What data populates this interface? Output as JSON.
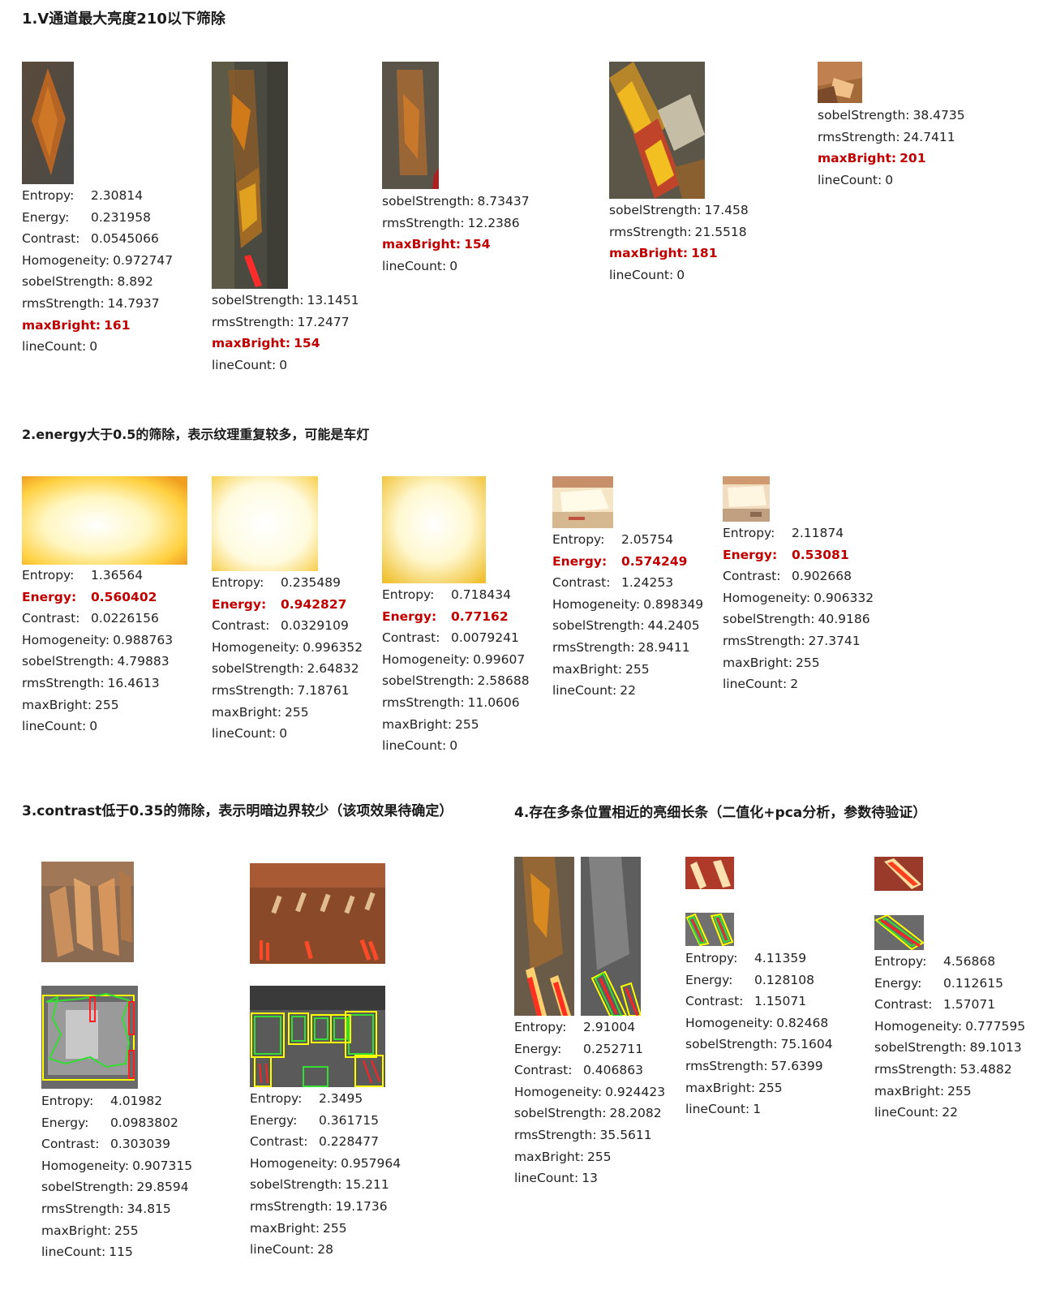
{
  "sections": {
    "s1": "1.V通道最大亮度210以下筛除",
    "s2": "2.energy大于0.5的筛除，表示纹理重复较多，可能是车灯",
    "s3": "3.contrast低于0.35的筛除，表示明暗边界较少（该项效果待确定）",
    "s4": "4.存在多条位置相近的亮细长条（二值化+pca分析，参数待验证）"
  },
  "samples": {
    "a1": [
      [
        "Entropy:",
        "2.30814",
        false
      ],
      [
        "Energy:",
        "0.231958",
        false
      ],
      [
        "Contrast:",
        "0.0545066",
        false
      ],
      [
        "Homogeneity:",
        "0.972747",
        false
      ],
      [
        "sobelStrength:",
        "8.892",
        false
      ],
      [
        "rmsStrength:",
        "14.7937",
        false
      ],
      [
        "maxBright:",
        "161",
        true
      ],
      [
        "lineCount:",
        "0",
        false
      ]
    ],
    "a2": [
      [
        "sobelStrength:",
        "13.1451",
        false
      ],
      [
        "rmsStrength:",
        "17.2477",
        false
      ],
      [
        "maxBright:",
        "154",
        true
      ],
      [
        "lineCount:",
        "0",
        false
      ]
    ],
    "a3": [
      [
        "sobelStrength:",
        "8.73437",
        false
      ],
      [
        "rmsStrength:",
        "12.2386",
        false
      ],
      [
        "maxBright:",
        "154",
        true
      ],
      [
        "lineCount:",
        "0",
        false
      ]
    ],
    "a4": [
      [
        "sobelStrength:",
        "17.458",
        false
      ],
      [
        "rmsStrength:",
        "21.5518",
        false
      ],
      [
        "maxBright:",
        "181",
        true
      ],
      [
        "lineCount:",
        "0",
        false
      ]
    ],
    "a5": [
      [
        "sobelStrength:",
        "38.4735",
        false
      ],
      [
        "rmsStrength:",
        "24.7411",
        false
      ],
      [
        "maxBright:",
        "201",
        true
      ],
      [
        "lineCount:",
        "0",
        false
      ]
    ],
    "b1": [
      [
        "Entropy:",
        "1.36564",
        false
      ],
      [
        "Energy:",
        "0.560402",
        true
      ],
      [
        "Contrast:",
        "0.0226156",
        false
      ],
      [
        "Homogeneity:",
        "0.988763",
        false
      ],
      [
        "sobelStrength:",
        "4.79883",
        false
      ],
      [
        "rmsStrength:",
        "16.4613",
        false
      ],
      [
        "maxBright:",
        "255",
        false
      ],
      [
        "lineCount:",
        "0",
        false
      ]
    ],
    "b2": [
      [
        "Entropy:",
        "0.235489",
        false
      ],
      [
        "Energy:",
        "0.942827",
        true
      ],
      [
        "Contrast:",
        "0.0329109",
        false
      ],
      [
        "Homogeneity:",
        "0.996352",
        false
      ],
      [
        "sobelStrength:",
        "2.64832",
        false
      ],
      [
        "rmsStrength:",
        "7.18761",
        false
      ],
      [
        "maxBright:",
        "255",
        false
      ],
      [
        "lineCount:",
        "0",
        false
      ]
    ],
    "b3": [
      [
        "Entropy:",
        "0.718434",
        false
      ],
      [
        "Energy:",
        "0.77162",
        true
      ],
      [
        "Contrast:",
        "0.0079241",
        false
      ],
      [
        "Homogeneity:",
        "0.99607",
        false
      ],
      [
        "sobelStrength:",
        "2.58688",
        false
      ],
      [
        "rmsStrength:",
        "11.0606",
        false
      ],
      [
        "maxBright:",
        "255",
        false
      ],
      [
        "lineCount:",
        "0",
        false
      ]
    ],
    "b4": [
      [
        "Entropy:",
        "2.05754",
        false
      ],
      [
        "Energy:",
        "0.574249",
        true
      ],
      [
        "Contrast:",
        "1.24253",
        false
      ],
      [
        "Homogeneity:",
        "0.898349",
        false
      ],
      [
        "sobelStrength:",
        "44.2405",
        false
      ],
      [
        "rmsStrength:",
        "28.9411",
        false
      ],
      [
        "maxBright:",
        "255",
        false
      ],
      [
        "lineCount:",
        "22",
        false
      ]
    ],
    "b5": [
      [
        "Entropy:",
        "2.11874",
        false
      ],
      [
        "Energy:",
        "0.53081",
        true
      ],
      [
        "Contrast:",
        "0.902668",
        false
      ],
      [
        "Homogeneity:",
        "0.906332",
        false
      ],
      [
        "sobelStrength:",
        "40.9186",
        false
      ],
      [
        "rmsStrength:",
        "27.3741",
        false
      ],
      [
        "maxBright:",
        "255",
        false
      ],
      [
        "lineCount:",
        "2",
        false
      ]
    ],
    "c1": [
      [
        "Entropy:",
        "4.01982",
        false
      ],
      [
        "Energy:",
        "0.0983802",
        false
      ],
      [
        "Contrast:",
        "0.303039",
        false
      ],
      [
        "Homogeneity:",
        "0.907315",
        false
      ],
      [
        "sobelStrength:",
        "29.8594",
        false
      ],
      [
        "rmsStrength:",
        "34.815",
        false
      ],
      [
        "maxBright:",
        "255",
        false
      ],
      [
        "lineCount:",
        "115",
        false
      ]
    ],
    "c2": [
      [
        "Entropy:",
        "2.3495",
        false
      ],
      [
        "Energy:",
        "0.361715",
        false
      ],
      [
        "Contrast:",
        "0.228477",
        false
      ],
      [
        "Homogeneity:",
        "0.957964",
        false
      ],
      [
        "sobelStrength:",
        "15.211",
        false
      ],
      [
        "rmsStrength:",
        "19.1736",
        false
      ],
      [
        "maxBright:",
        "255",
        false
      ],
      [
        "lineCount:",
        "28",
        false
      ]
    ],
    "d1": [
      [
        "Entropy:",
        "2.91004",
        false
      ],
      [
        "Energy:",
        "0.252711",
        false
      ],
      [
        "Contrast:",
        "0.406863",
        false
      ],
      [
        "Homogeneity:",
        "0.924423",
        false
      ],
      [
        "sobelStrength:",
        "28.2082",
        false
      ],
      [
        "rmsStrength:",
        "35.5611",
        false
      ],
      [
        "maxBright:",
        "255",
        false
      ],
      [
        "lineCount:",
        "13",
        false
      ]
    ],
    "d2": [
      [
        "Entropy:",
        "4.11359",
        false
      ],
      [
        "Energy:",
        "0.128108",
        false
      ],
      [
        "Contrast:",
        "1.15071",
        false
      ],
      [
        "Homogeneity:",
        "0.82468",
        false
      ],
      [
        "sobelStrength:",
        "75.1604",
        false
      ],
      [
        "rmsStrength:",
        "57.6399",
        false
      ],
      [
        "maxBright:",
        "255",
        false
      ],
      [
        "lineCount:",
        "1",
        false
      ]
    ],
    "d3": [
      [
        "Entropy:",
        "4.56868",
        false
      ],
      [
        "Energy:",
        "0.112615",
        false
      ],
      [
        "Contrast:",
        "1.57071",
        false
      ],
      [
        "Homogeneity:",
        "0.777595",
        false
      ],
      [
        "sobelStrength:",
        "89.1013",
        false
      ],
      [
        "rmsStrength:",
        "53.4882",
        false
      ],
      [
        "maxBright:",
        "255",
        false
      ],
      [
        "lineCount:",
        "22",
        false
      ]
    ]
  },
  "colors": {
    "highlight": "#c00000",
    "contour": "#33dd33",
    "box": "#ffff00",
    "line": "#ff2222"
  }
}
